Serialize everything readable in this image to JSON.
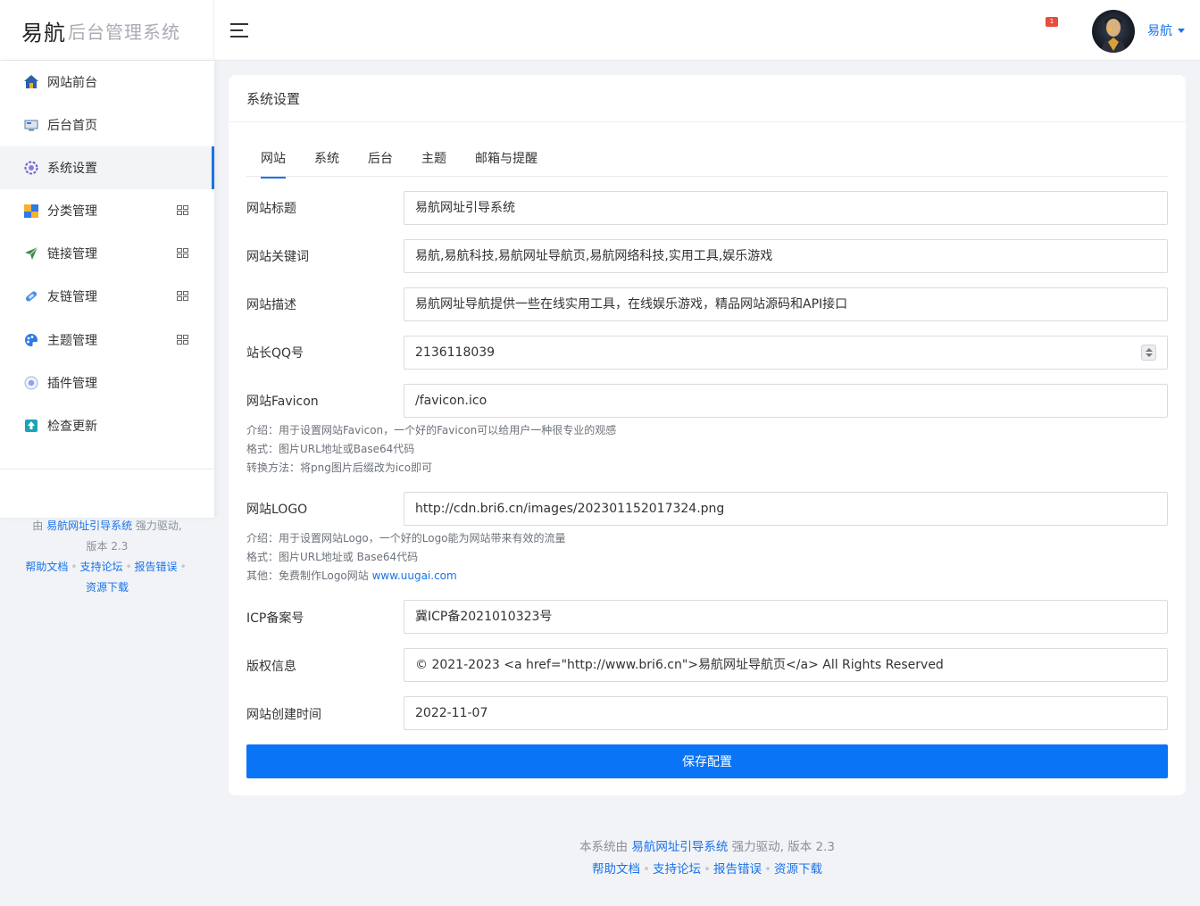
{
  "brand": {
    "main": "易航",
    "sub": "后台管理系统"
  },
  "header": {
    "notification_count": "1",
    "username": "易航"
  },
  "sidebar": {
    "items": [
      {
        "label": "网站前台",
        "icon": "home-icon"
      },
      {
        "label": "后台首页",
        "icon": "dashboard-icon"
      },
      {
        "label": "系统设置",
        "icon": "settings-icon",
        "active": true
      },
      {
        "label": "分类管理",
        "icon": "category-icon",
        "expandable": true
      },
      {
        "label": "链接管理",
        "icon": "send-icon",
        "expandable": true
      },
      {
        "label": "友链管理",
        "icon": "link-icon",
        "expandable": true
      },
      {
        "label": "主题管理",
        "icon": "palette-icon",
        "expandable": true
      },
      {
        "label": "插件管理",
        "icon": "plugin-icon"
      },
      {
        "label": "检查更新",
        "icon": "update-icon"
      }
    ],
    "footer": {
      "prefix": "由",
      "system_link": "易航网址引导系统",
      "suffix": "强力驱动,",
      "version": "版本 2.3",
      "links": [
        "帮助文档",
        "支持论坛",
        "报告错误",
        "资源下载"
      ]
    }
  },
  "card": {
    "title": "系统设置",
    "tabs": [
      "网站",
      "系统",
      "后台",
      "主题",
      "邮箱与提醒"
    ],
    "active_tab": "网站"
  },
  "form": {
    "site_title": {
      "label": "网站标题",
      "value": "易航网址引导系统"
    },
    "keywords": {
      "label": "网站关键词",
      "value": "易航,易航科技,易航网址导航页,易航网络科技,实用工具,娱乐游戏"
    },
    "description": {
      "label": "网站描述",
      "value": "易航网址导航提供一些在线实用工具，在线娱乐游戏，精品网站源码和API接口"
    },
    "qq": {
      "label": "站长QQ号",
      "value": "2136118039"
    },
    "favicon": {
      "label": "网站Favicon",
      "value": "/favicon.ico",
      "help": [
        "介绍：用于设置网站Favicon，一个好的Favicon可以给用户一种很专业的观感",
        "格式：图片URL地址或Base64代码",
        "转换方法：将png图片后缀改为ico即可"
      ]
    },
    "logo": {
      "label": "网站LOGO",
      "value": "http://cdn.bri6.cn/images/202301152017324.png",
      "help": [
        "介绍：用于设置网站Logo，一个好的Logo能为网站带来有效的流量",
        "格式：图片URL地址或 Base64代码"
      ],
      "help_other_prefix": "其他：免费制作Logo网站 ",
      "help_other_link": "www.uugai.com"
    },
    "icp": {
      "label": "ICP备案号",
      "value": "冀ICP备2021010323号"
    },
    "copyright": {
      "label": "版权信息",
      "value": "© 2021-2023 <a href=\"http://www.bri6.cn\">易航网址导航页</a> All Rights Reserved"
    },
    "created": {
      "label": "网站创建时间",
      "value": "2022-11-07"
    },
    "save_label": "保存配置"
  },
  "page_footer": {
    "prefix": "本系统由",
    "system_link": "易航网址引导系统",
    "suffix": "强力驱动, 版本 2.3",
    "links": [
      "帮助文档",
      "支持论坛",
      "报告错误",
      "资源下载"
    ]
  }
}
